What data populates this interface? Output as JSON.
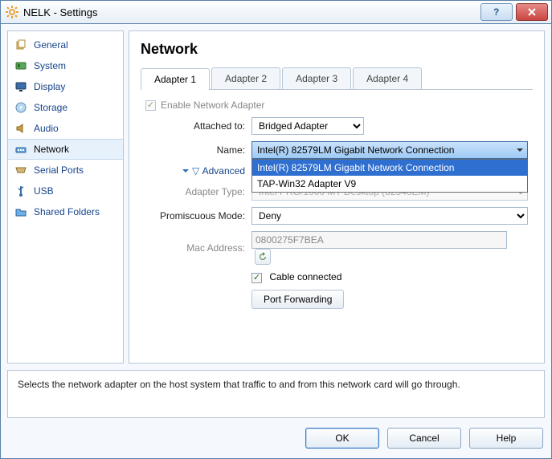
{
  "titlebar": {
    "title": "NELK - Settings"
  },
  "sidebar": {
    "items": [
      {
        "label": "General"
      },
      {
        "label": "System"
      },
      {
        "label": "Display"
      },
      {
        "label": "Storage"
      },
      {
        "label": "Audio"
      },
      {
        "label": "Network"
      },
      {
        "label": "Serial Ports"
      },
      {
        "label": "USB"
      },
      {
        "label": "Shared Folders"
      }
    ]
  },
  "main": {
    "heading": "Network",
    "tabs": [
      {
        "label": "Adapter 1"
      },
      {
        "label": "Adapter 2"
      },
      {
        "label": "Adapter 3"
      },
      {
        "label": "Adapter 4"
      }
    ],
    "enable_label": "Enable Network Adapter",
    "attached_label": "Attached to:",
    "attached_value": "Bridged Adapter",
    "name_label": "Name:",
    "name_value": "Intel(R) 82579LM Gigabit Network Connection",
    "name_options": [
      "Intel(R) 82579LM Gigabit Network Connection",
      "TAP-Win32 Adapter V9"
    ],
    "advanced_label": "Advanced",
    "adapter_type_label": "Adapter Type:",
    "adapter_type_value": "Intel PRO/1000 MT Desktop (82540EM)",
    "promisc_label": "Promiscuous Mode:",
    "promisc_value": "Deny",
    "mac_label": "Mac Address:",
    "mac_value": "0800275F7BEA",
    "cable_label": "Cable connected",
    "portfwd_label": "Port Forwarding"
  },
  "description": "Selects the network adapter on the host system that traffic to and from this network card will go through.",
  "buttons": {
    "ok": "OK",
    "cancel": "Cancel",
    "help": "Help"
  }
}
